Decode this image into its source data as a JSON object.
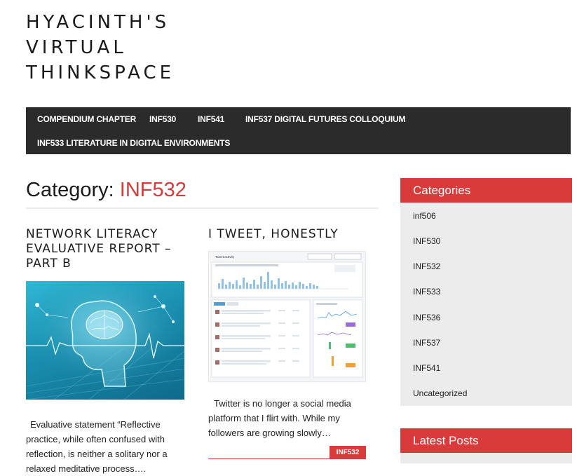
{
  "site": {
    "title_lines": [
      "HYACINTH'S",
      "VIRTUAL",
      "THINKSPACE"
    ]
  },
  "nav": {
    "items": [
      "COMPENDIUM CHAPTER",
      "INF530",
      "INF541",
      "INF537 DIGITAL FUTURES COLLOQUIUM",
      "INF533 LITERATURE IN DIGITAL ENVIRONMENTS"
    ]
  },
  "archive": {
    "prefix": "Category:",
    "name": "INF532"
  },
  "posts": [
    {
      "title_lines": [
        "NETWORK LITERACY",
        "EVALUATIVE REPORT –",
        "PART B"
      ],
      "excerpt": "Evaluative statement “Reflective practice, while often confused with reflection, is neither a solitary nor a relaxed meditative process…."
    },
    {
      "title_lines": [
        "I TWEET, HONESTLY"
      ],
      "excerpt": "Twitter is no longer a social media platform that I flirt with. While my followers are growing slowly…",
      "category_tag": "INF532",
      "thumbnail": {
        "heading": "Tweet activity"
      }
    }
  ],
  "sidebar": {
    "categories_title": "Categories",
    "categories": [
      "inf506",
      "INF530",
      "INF532",
      "INF533",
      "INF536",
      "INF537",
      "INF541",
      "Uncategorized"
    ],
    "latest_title": "Latest Posts"
  },
  "colors": {
    "accent": "#d93a3a",
    "nav_bg": "#2b2b2b",
    "widget_bg": "#ececec"
  }
}
